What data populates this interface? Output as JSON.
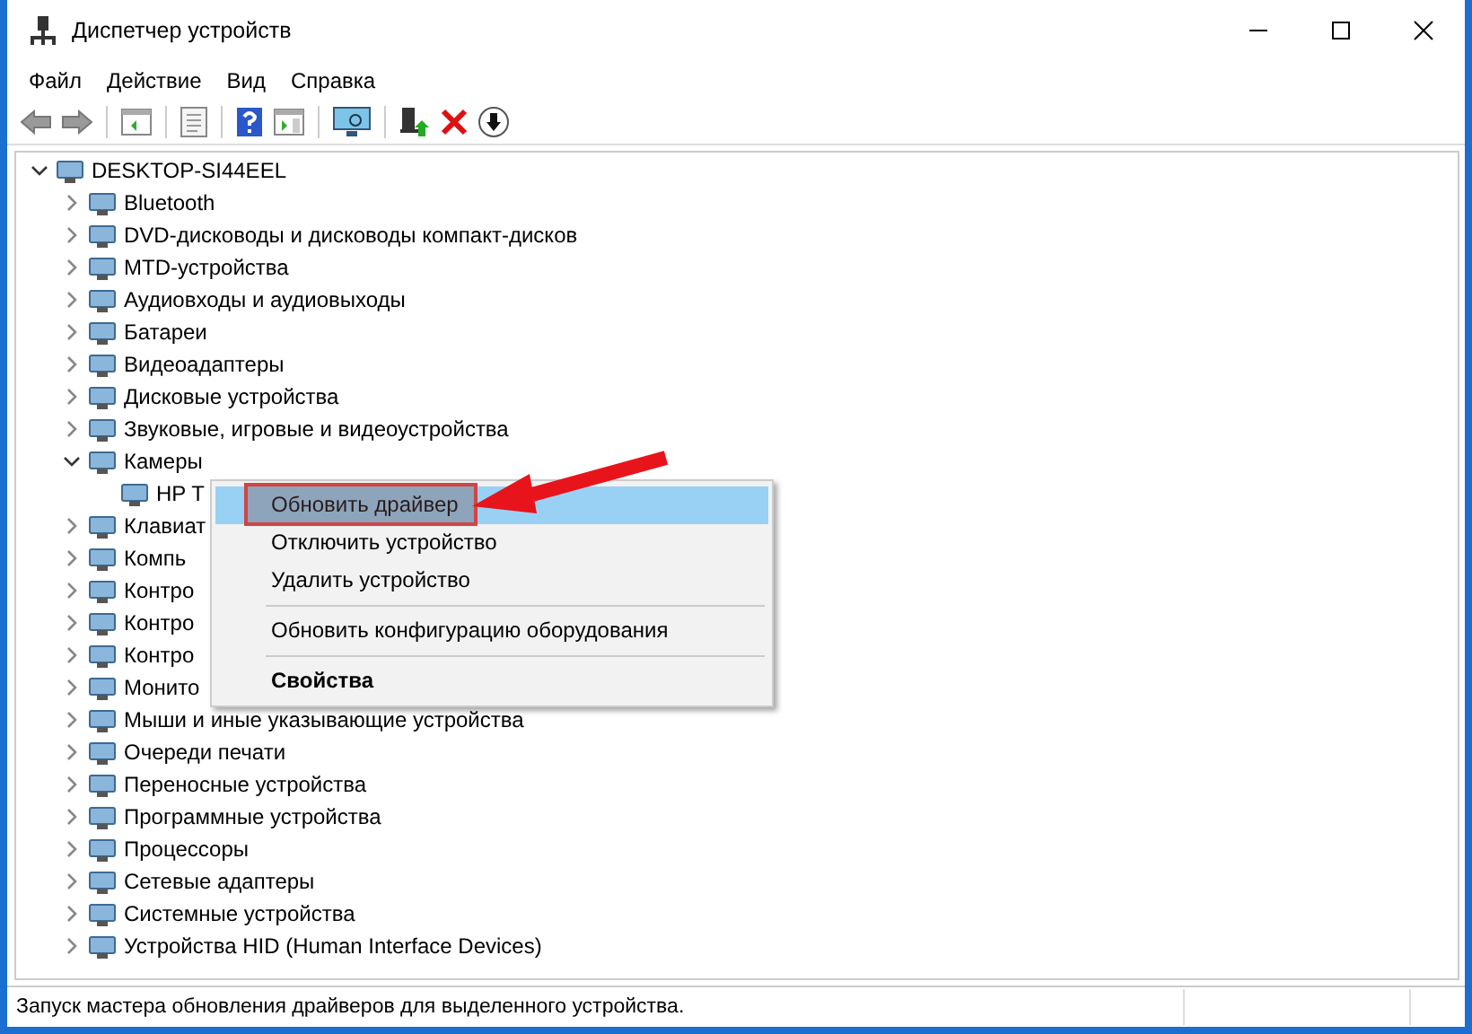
{
  "window": {
    "title": "Диспетчер устройств"
  },
  "menu_bar": [
    "Файл",
    "Действие",
    "Вид",
    "Справка"
  ],
  "tree": {
    "label": "DESKTOP-SI44EEL",
    "expanded": true,
    "children": [
      {
        "label": "Bluetooth",
        "expanded": false
      },
      {
        "label": "DVD-дисководы и дисководы компакт-дисков",
        "expanded": false
      },
      {
        "label": "MTD-устройства",
        "expanded": false
      },
      {
        "label": "Аудиовходы и аудиовыходы",
        "expanded": false
      },
      {
        "label": "Батареи",
        "expanded": false
      },
      {
        "label": "Видеоадаптеры",
        "expanded": false
      },
      {
        "label": "Дисковые устройства",
        "expanded": false
      },
      {
        "label": "Звуковые, игровые и видеоустройства",
        "expanded": false
      },
      {
        "label": "Камеры",
        "expanded": true,
        "children": [
          {
            "label": "HP T"
          }
        ]
      },
      {
        "label": "Клавиат",
        "expanded": false
      },
      {
        "label": "Компь",
        "expanded": false
      },
      {
        "label": "Контро",
        "expanded": false
      },
      {
        "label": "Контро",
        "expanded": false
      },
      {
        "label": "Контро",
        "expanded": false
      },
      {
        "label": "Монито",
        "expanded": false
      },
      {
        "label": "Мыши и иные указывающие устройства",
        "expanded": false
      },
      {
        "label": "Очереди печати",
        "expanded": false
      },
      {
        "label": "Переносные устройства",
        "expanded": false
      },
      {
        "label": "Программные устройства",
        "expanded": false
      },
      {
        "label": "Процессоры",
        "expanded": false
      },
      {
        "label": "Сетевые адаптеры",
        "expanded": false
      },
      {
        "label": "Системные устройства",
        "expanded": false
      },
      {
        "label": "Устройства HID (Human Interface Devices)",
        "expanded": false
      }
    ]
  },
  "context_menu": [
    {
      "kind": "command",
      "label": "Обновить драйвер",
      "selected": true
    },
    {
      "kind": "command",
      "label": "Отключить устройство",
      "selected": false
    },
    {
      "kind": "command",
      "label": "Удалить устройство",
      "selected": false
    },
    {
      "kind": "separator"
    },
    {
      "kind": "command",
      "label": "Обновить конфигурацию оборудования",
      "selected": false
    },
    {
      "kind": "separator"
    },
    {
      "kind": "default",
      "label": "Свойства",
      "selected": false
    }
  ],
  "status_bar": "Запуск мастера обновления драйверов для выделенного устройства."
}
